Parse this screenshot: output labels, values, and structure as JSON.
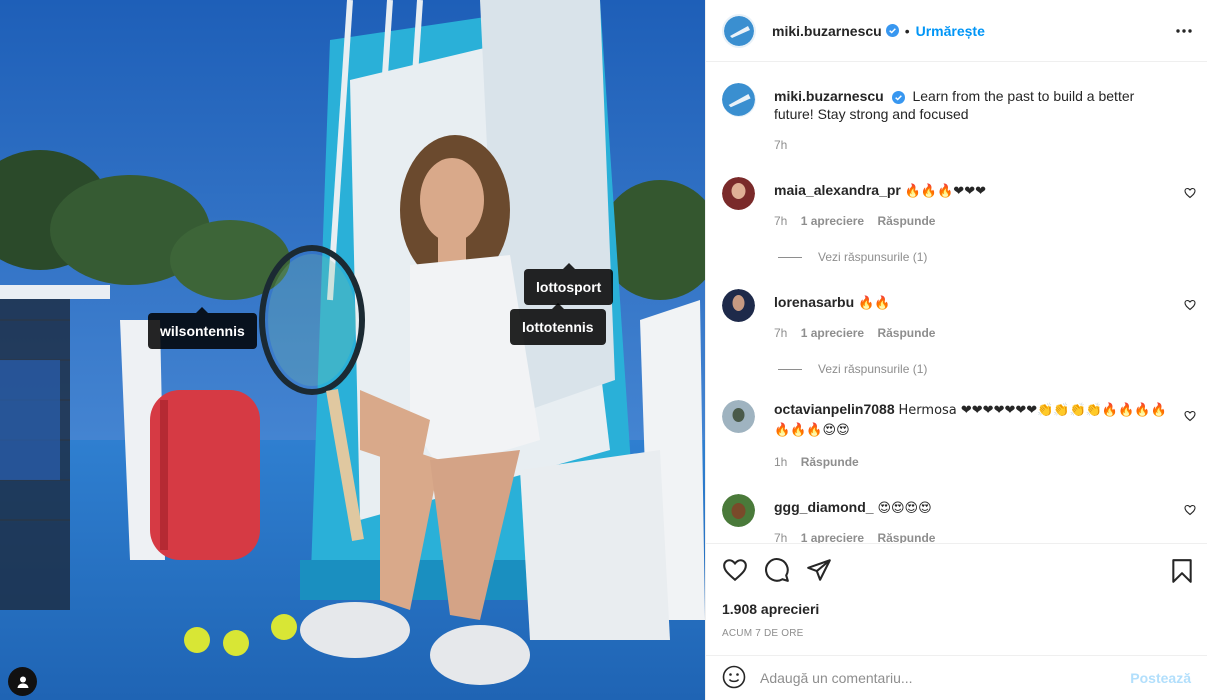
{
  "post": {
    "image_alt": "Tennis player sitting on a courtside chair holding a racket",
    "tags": [
      "wilsontennis",
      "lottosport",
      "lottotennis"
    ]
  },
  "header": {
    "username": "miki.buzarnescu",
    "separator": "•",
    "follow_label": "Urmărește",
    "more_icon": "more-horizontal-icon"
  },
  "caption": {
    "username": "miki.buzarnescu",
    "text": "Learn from the past to build a better future! Stay strong and focused",
    "time": "7h"
  },
  "comments": [
    {
      "username": "maia_alexandra_pr",
      "text": "🔥🔥🔥❤❤❤",
      "time": "7h",
      "likes": "1 apreciere",
      "reply": "Răspunde",
      "view_replies": "Vezi răspunsurile (1)"
    },
    {
      "username": "lorenasarbu",
      "text": "🔥🔥",
      "time": "7h",
      "likes": "1 apreciere",
      "reply": "Răspunde",
      "view_replies": "Vezi răspunsurile (1)"
    },
    {
      "username": "octavianpelin7088",
      "text": "Hermosa ❤❤❤❤❤❤❤👏👏👏👏🔥🔥🔥🔥🔥🔥🔥😍😍",
      "time": "1h",
      "reply": "Răspunde"
    },
    {
      "username": "ggg_diamond_",
      "text": "😍😍😍😍",
      "time": "7h",
      "likes": "1 apreciere",
      "reply": "Răspunde"
    }
  ],
  "actions": {
    "likes": "1.908 aprecieri",
    "timestamp": "ACUM 7 DE ORE"
  },
  "add_comment": {
    "placeholder": "Adaugă un comentariu...",
    "post_label": "Postează"
  },
  "colors": {
    "accent": "#0095f6",
    "court_blue": "#2f78c4",
    "bag_red": "#d63a44"
  }
}
